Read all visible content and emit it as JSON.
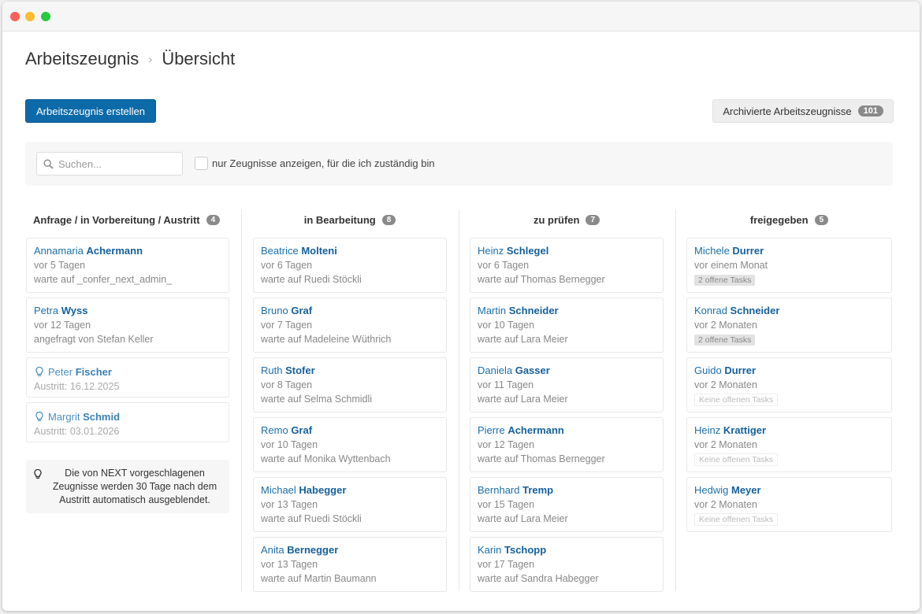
{
  "breadcrumb": {
    "root": "Arbeitszeugnis",
    "current": "Übersicht"
  },
  "toolbar": {
    "create_label": "Arbeitszeugnis erstellen",
    "archive_label": "Archivierte Arbeitszeugnisse",
    "archive_count": "101"
  },
  "filter": {
    "search_placeholder": "Suchen...",
    "checkbox_label": "nur Zeugnisse anzeigen, für die ich zuständig bin"
  },
  "colors": {
    "primary": "#0d6aa8",
    "link": "#1d6fa8",
    "badge": "#8a8a8a"
  },
  "columns": [
    {
      "title": "Anfrage / in Vorbereitung / Austritt",
      "count": "4",
      "cards": [
        {
          "first": "Annamaria",
          "last": "Achermann",
          "line1": "vor 5 Tagen",
          "line2": "warte auf _confer_next_admin_"
        },
        {
          "first": "Petra",
          "last": "Wyss",
          "line1": "vor 12 Tagen",
          "line2": "angefragt von Stefan Keller"
        },
        {
          "first": "Peter",
          "last": "Fischer",
          "line1": "Austritt: 16.12.2025",
          "icon": "lightbulb-icon"
        },
        {
          "first": "Margrit",
          "last": "Schmid",
          "line1": "Austritt: 03.01.2026",
          "icon": "lightbulb-icon"
        }
      ],
      "info": "Die von NEXT vorgeschlagenen Zeugnisse werden 30 Tage nach dem Austritt automatisch ausgeblendet."
    },
    {
      "title": "in Bearbeitung",
      "count": "8",
      "cards": [
        {
          "first": "Beatrice",
          "last": "Molteni",
          "line1": "vor 6 Tagen",
          "line2": "warte auf Ruedi Stöckli"
        },
        {
          "first": "Bruno",
          "last": "Graf",
          "line1": "vor 7 Tagen",
          "line2": "warte auf Madeleine Wüthrich"
        },
        {
          "first": "Ruth",
          "last": "Stofer",
          "line1": "vor 8 Tagen",
          "line2": "warte auf Selma Schmidli"
        },
        {
          "first": "Remo",
          "last": "Graf",
          "line1": "vor 10 Tagen",
          "line2": "warte auf Monika Wyttenbach"
        },
        {
          "first": "Michael",
          "last": "Habegger",
          "line1": "vor 13 Tagen",
          "line2": "warte auf Ruedi Stöckli"
        },
        {
          "first": "Anita",
          "last": "Bernegger",
          "line1": "vor 13 Tagen",
          "line2": "warte auf Martin Baumann"
        }
      ]
    },
    {
      "title": "zu prüfen",
      "count": "7",
      "cards": [
        {
          "first": "Heinz",
          "last": "Schlegel",
          "line1": "vor 6 Tagen",
          "line2": "warte auf Thomas Bernegger"
        },
        {
          "first": "Martin",
          "last": "Schneider",
          "line1": "vor 10 Tagen",
          "line2": "warte auf Lara Meier"
        },
        {
          "first": "Daniela",
          "last": "Gasser",
          "line1": "vor 11 Tagen",
          "line2": "warte auf Lara Meier"
        },
        {
          "first": "Pierre",
          "last": "Achermann",
          "line1": "vor 12 Tagen",
          "line2": "warte auf Thomas Bernegger"
        },
        {
          "first": "Bernhard",
          "last": "Tremp",
          "line1": "vor 15 Tagen",
          "line2": "warte auf Lara Meier"
        },
        {
          "first": "Karin",
          "last": "Tschopp",
          "line1": "vor 17 Tagen",
          "line2": "warte auf Sandra Habegger"
        }
      ]
    },
    {
      "title": "freigegeben",
      "count": "5",
      "cards": [
        {
          "first": "Michele",
          "last": "Durrer",
          "line1": "vor einem Monat",
          "task": "2 offene Tasks",
          "task_type": "open"
        },
        {
          "first": "Konrad",
          "last": "Schneider",
          "line1": "vor 2 Monaten",
          "task": "2 offene Tasks",
          "task_type": "open"
        },
        {
          "first": "Guido",
          "last": "Durrer",
          "line1": "vor 2 Monaten",
          "task": "Keine offenen Tasks",
          "task_type": "none"
        },
        {
          "first": "Heinz",
          "last": "Krattiger",
          "line1": "vor 2 Monaten",
          "task": "Keine offenen Tasks",
          "task_type": "none"
        },
        {
          "first": "Hedwig",
          "last": "Meyer",
          "line1": "vor 2 Monaten",
          "task": "Keine offenen Tasks",
          "task_type": "none"
        }
      ]
    }
  ]
}
